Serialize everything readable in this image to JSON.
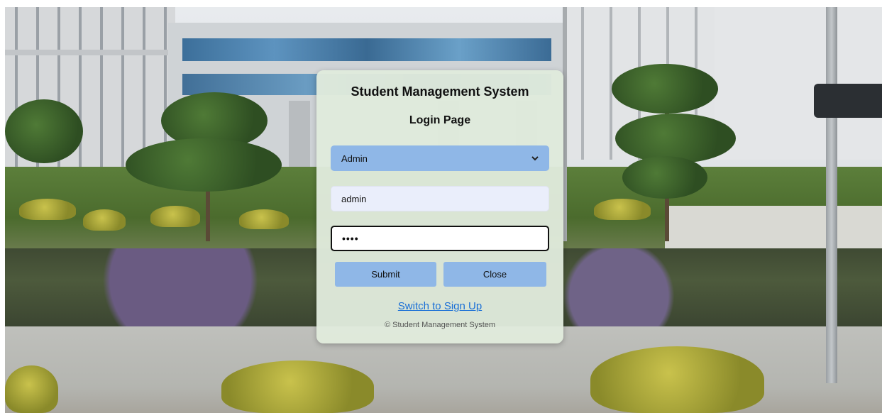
{
  "app_title": "Student Management System",
  "page_subtitle": "Login Page",
  "role_select": {
    "selected": "Admin"
  },
  "username_input": {
    "value": "admin"
  },
  "password_input": {
    "masked_value": "••••"
  },
  "buttons": {
    "submit": "Submit",
    "close": "Close"
  },
  "switch_link": "Switch to Sign Up",
  "footer": "© Student Management System",
  "colors": {
    "card_bg": "#e0eadc",
    "button_blue": "#8fb7e7",
    "link_blue": "#1a6fd6",
    "input_bg": "#eaeefb"
  },
  "icons": {
    "select_arrow": "chevron-down-icon"
  }
}
